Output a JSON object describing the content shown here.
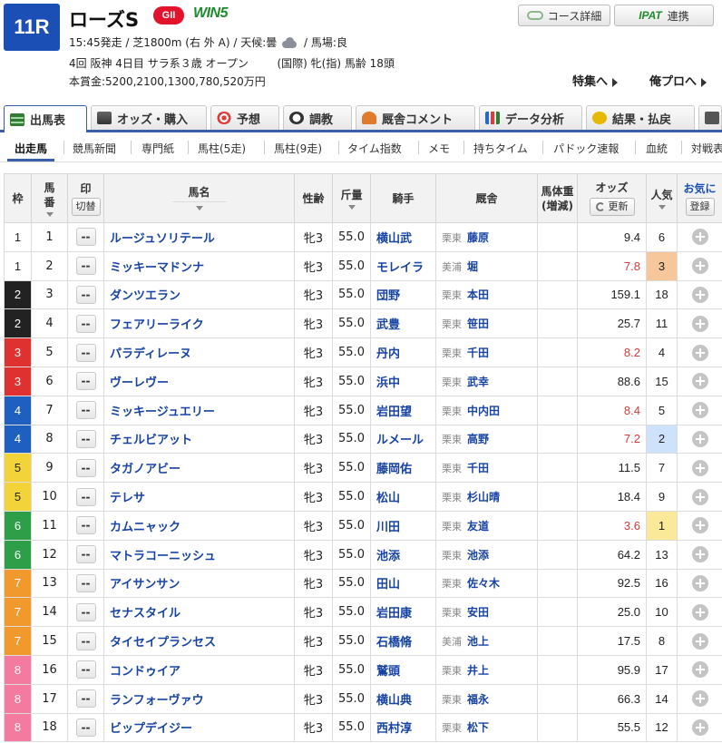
{
  "race": {
    "number": "11R",
    "name": "ローズS",
    "grade": "GII",
    "win5": "WIN5",
    "start": "15:45発走",
    "course": "芝1800m (右 外 A)",
    "weather_label": "天候:曇",
    "weather_icon": "cloud-icon",
    "track": "馬場:良",
    "meeting": "4回 阪神 4日目",
    "class": "サラ系３歳 オープン",
    "conditions": "(国際) 牝(指) 馬齢 18頭",
    "prize": "本賞金:5200,2100,1300,780,520万円"
  },
  "header_buttons": {
    "course_detail": "コース詳細",
    "ipat_logo": "IPAT",
    "ipat_link": "連携",
    "feature": "特集へ",
    "orepro": "俺プロへ"
  },
  "main_tabs": [
    {
      "label": "出馬表",
      "icon": "table-icon"
    },
    {
      "label": "オッズ・購入",
      "icon": "odds-icon"
    },
    {
      "label": "予想",
      "icon": "target-icon"
    },
    {
      "label": "調教",
      "icon": "stopwatch-icon"
    },
    {
      "label": "厩舎コメント",
      "icon": "stable-icon"
    },
    {
      "label": "データ分析",
      "icon": "bar-chart-icon"
    },
    {
      "label": "結果・払戻",
      "icon": "coins-icon"
    }
  ],
  "sub_tabs": [
    "出走馬",
    "競馬新聞",
    "専門紙",
    "馬柱(5走)",
    "馬柱(9走)",
    "タイム指数",
    "メモ",
    "持ちタイム",
    "パドック速報",
    "血統",
    "対戦表"
  ],
  "table": {
    "headers": {
      "waku": "枠",
      "umaban_1": "馬",
      "umaban_2": "番",
      "mark": "印",
      "mark_toggle": "切替",
      "name": "馬名",
      "sex_age": "性齢",
      "weight": "斤量",
      "jockey": "騎手",
      "stable": "厩舎",
      "body_weight_1": "馬体重",
      "body_weight_2": "(増減)",
      "odds": "オッズ",
      "update": "更新",
      "popularity": "人気",
      "favorite": "お気に",
      "register": "登録"
    },
    "mark_placeholder": "--",
    "colors": {
      "waku": [
        "#ffffff",
        "#222222",
        "#e03131",
        "#1f5fbf",
        "#f3d33a",
        "#2e9e48",
        "#f2992e",
        "#f47aa0"
      ],
      "odds_hot": "#d63a3a",
      "pop1_bg": "#fbe99a",
      "pop2_bg": "#cfe2fb",
      "pop3_bg": "#f6c79a"
    },
    "rows": [
      {
        "waku": "1",
        "num": "1",
        "name": "ルージュソリテール",
        "sex": "牝3",
        "weight": "55.0",
        "jockey": "横山武",
        "region": "栗東",
        "trainer": "藤原",
        "odds": "9.4",
        "pop": "6"
      },
      {
        "waku": "1",
        "num": "2",
        "name": "ミッキーマドンナ",
        "sex": "牝3",
        "weight": "55.0",
        "jockey": "モレイラ",
        "region": "美浦",
        "trainer": "堀",
        "odds": "7.8",
        "pop": "3"
      },
      {
        "waku": "2",
        "num": "3",
        "name": "ダンツエラン",
        "sex": "牝3",
        "weight": "55.0",
        "jockey": "団野",
        "region": "栗東",
        "trainer": "本田",
        "odds": "159.1",
        "pop": "18"
      },
      {
        "waku": "2",
        "num": "4",
        "name": "フェアリーライク",
        "sex": "牝3",
        "weight": "55.0",
        "jockey": "武豊",
        "region": "栗東",
        "trainer": "笹田",
        "odds": "25.7",
        "pop": "11"
      },
      {
        "waku": "3",
        "num": "5",
        "name": "パラディレーヌ",
        "sex": "牝3",
        "weight": "55.0",
        "jockey": "丹内",
        "region": "栗東",
        "trainer": "千田",
        "odds": "8.2",
        "pop": "4"
      },
      {
        "waku": "3",
        "num": "6",
        "name": "ヴーレヴー",
        "sex": "牝3",
        "weight": "55.0",
        "jockey": "浜中",
        "region": "栗東",
        "trainer": "武幸",
        "odds": "88.6",
        "pop": "15"
      },
      {
        "waku": "4",
        "num": "7",
        "name": "ミッキージュエリー",
        "sex": "牝3",
        "weight": "55.0",
        "jockey": "岩田望",
        "region": "栗東",
        "trainer": "中内田",
        "odds": "8.4",
        "pop": "5"
      },
      {
        "waku": "4",
        "num": "8",
        "name": "チェルビアット",
        "sex": "牝3",
        "weight": "55.0",
        "jockey": "ルメール",
        "region": "栗東",
        "trainer": "高野",
        "odds": "7.2",
        "pop": "2"
      },
      {
        "waku": "5",
        "num": "9",
        "name": "タガノアビー",
        "sex": "牝3",
        "weight": "55.0",
        "jockey": "藤岡佑",
        "region": "栗東",
        "trainer": "千田",
        "odds": "11.5",
        "pop": "7"
      },
      {
        "waku": "5",
        "num": "10",
        "name": "テレサ",
        "sex": "牝3",
        "weight": "55.0",
        "jockey": "松山",
        "region": "栗東",
        "trainer": "杉山晴",
        "odds": "18.4",
        "pop": "9"
      },
      {
        "waku": "6",
        "num": "11",
        "name": "カムニャック",
        "sex": "牝3",
        "weight": "55.0",
        "jockey": "川田",
        "region": "栗東",
        "trainer": "友道",
        "odds": "3.6",
        "pop": "1"
      },
      {
        "waku": "6",
        "num": "12",
        "name": "マトラコーニッシュ",
        "sex": "牝3",
        "weight": "55.0",
        "jockey": "池添",
        "region": "栗東",
        "trainer": "池添",
        "odds": "64.2",
        "pop": "13"
      },
      {
        "waku": "7",
        "num": "13",
        "name": "アイサンサン",
        "sex": "牝3",
        "weight": "55.0",
        "jockey": "田山",
        "region": "栗東",
        "trainer": "佐々木",
        "odds": "92.5",
        "pop": "16"
      },
      {
        "waku": "7",
        "num": "14",
        "name": "セナスタイル",
        "sex": "牝3",
        "weight": "55.0",
        "jockey": "岩田康",
        "region": "栗東",
        "trainer": "安田",
        "odds": "25.0",
        "pop": "10"
      },
      {
        "waku": "7",
        "num": "15",
        "name": "タイセイプランセス",
        "sex": "牝3",
        "weight": "55.0",
        "jockey": "石橋脩",
        "region": "美浦",
        "trainer": "池上",
        "odds": "17.5",
        "pop": "8"
      },
      {
        "waku": "8",
        "num": "16",
        "name": "コンドゥイア",
        "sex": "牝3",
        "weight": "55.0",
        "jockey": "鷲頭",
        "region": "栗東",
        "trainer": "井上",
        "odds": "95.9",
        "pop": "17"
      },
      {
        "waku": "8",
        "num": "17",
        "name": "ランフォーヴァウ",
        "sex": "牝3",
        "weight": "55.0",
        "jockey": "横山典",
        "region": "栗東",
        "trainer": "福永",
        "odds": "66.3",
        "pop": "14"
      },
      {
        "waku": "8",
        "num": "18",
        "name": "ビップデイジー",
        "sex": "牝3",
        "weight": "55.0",
        "jockey": "西村淳",
        "region": "栗東",
        "trainer": "松下",
        "odds": "55.5",
        "pop": "12"
      }
    ]
  }
}
